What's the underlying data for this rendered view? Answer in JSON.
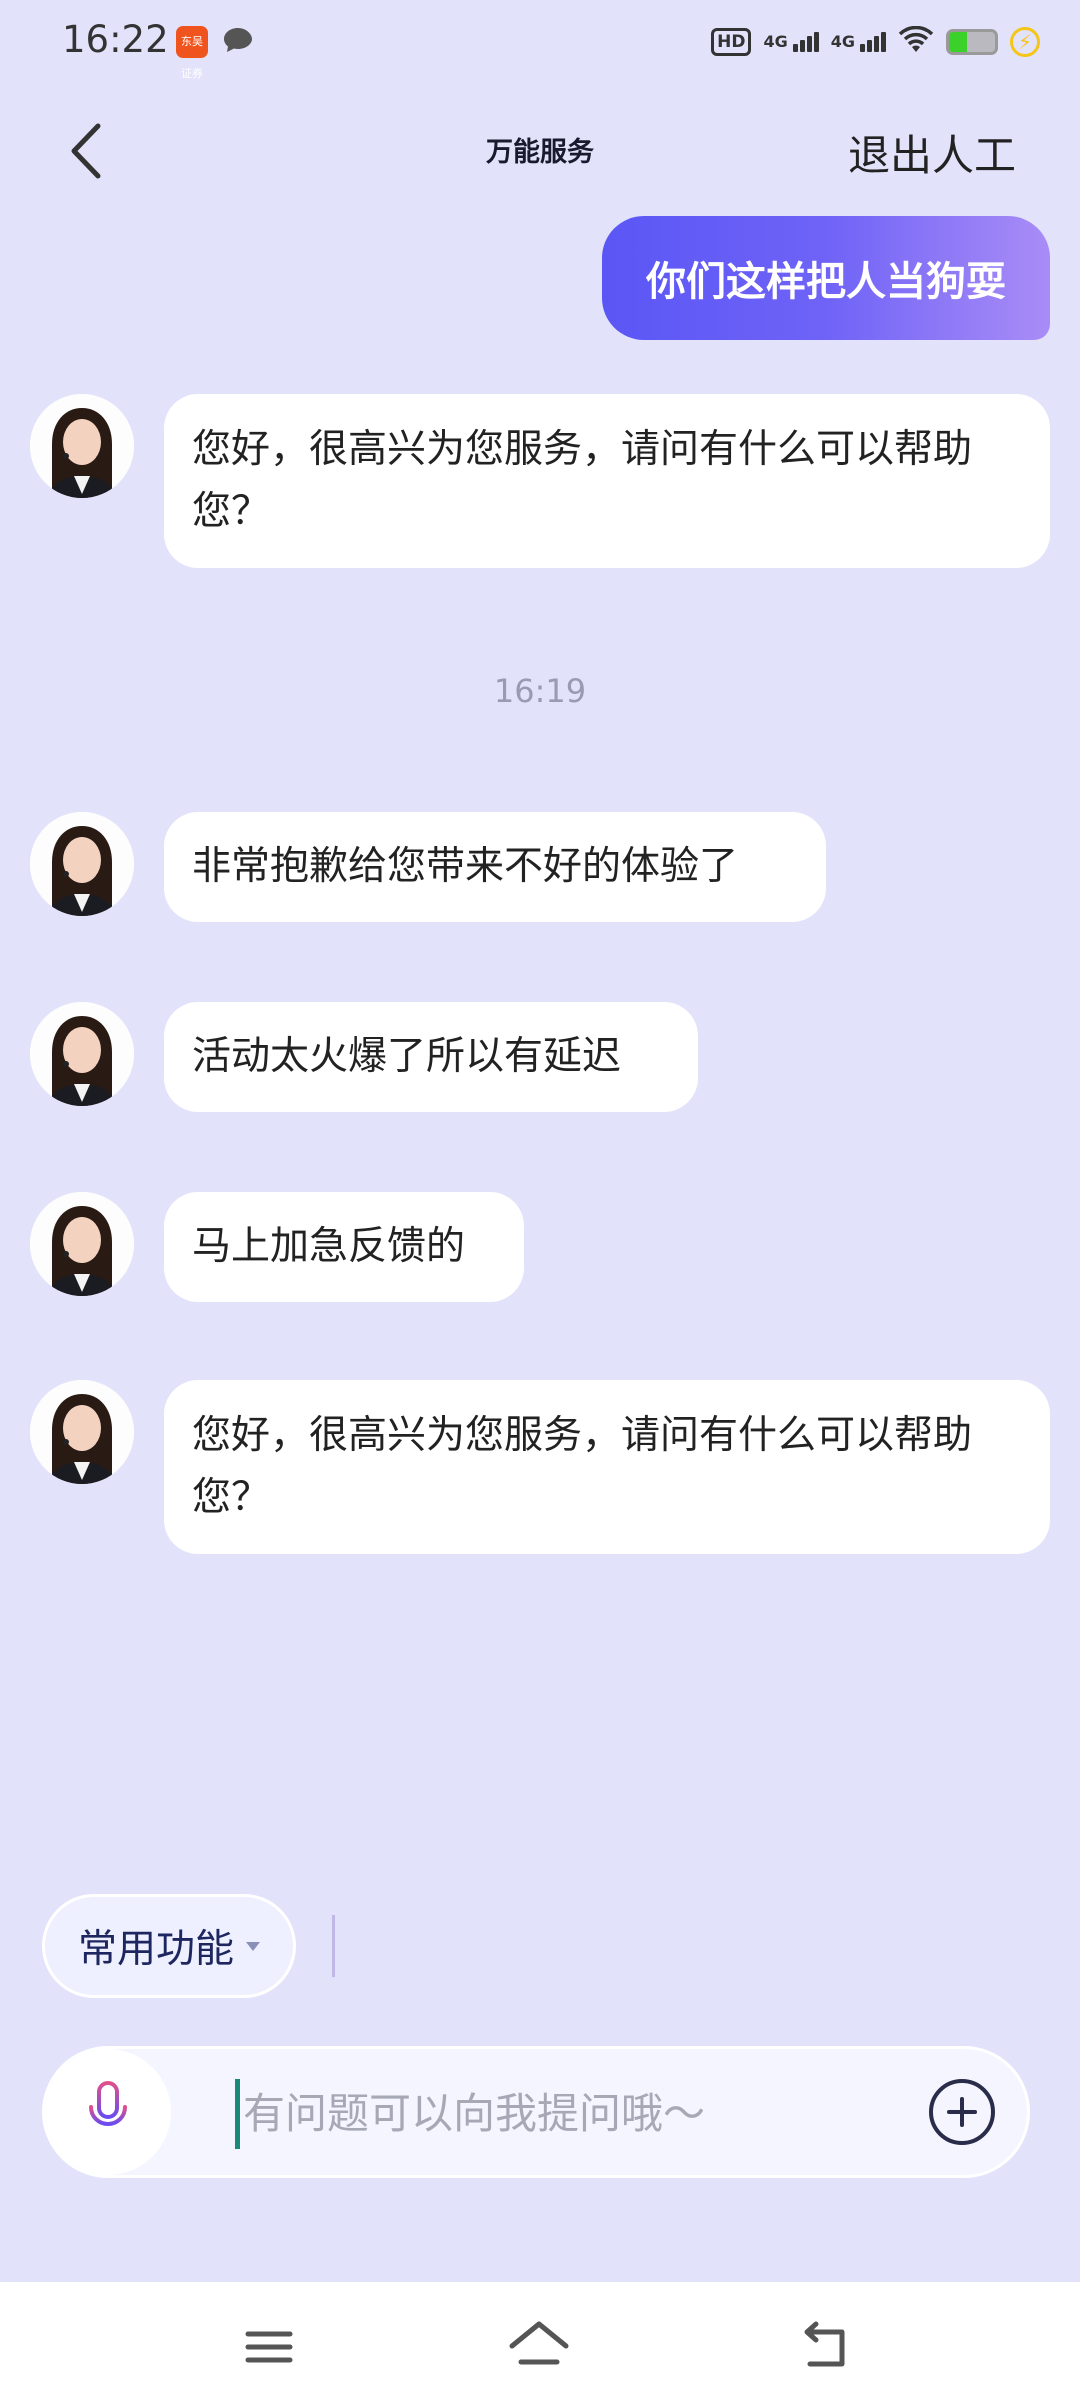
{
  "status_bar": {
    "time": "16:22",
    "app_badge": "东吴证券",
    "hd_label": "HD",
    "sim1_label": "4G",
    "sim2_label": "4G",
    "battery_level": 0.4,
    "icons": [
      "app-badge-icon",
      "message-icon",
      "hd-icon",
      "signal-icon",
      "signal-icon",
      "wifi-icon",
      "battery-icon",
      "charging-icon"
    ]
  },
  "header": {
    "title": "万能服务",
    "exit_label": "退出人工",
    "back_icon": "chevron-left-icon"
  },
  "chat": {
    "user_message": "你们这样把人当狗耍",
    "agent_messages": [
      "您好，很高兴为您服务，请问有什么可以帮助您？",
      "非常抱歉给您带来不好的体验了",
      "活动太火爆了所以有延迟",
      "马上加急反馈的",
      "您好，很高兴为您服务，请问有什么可以帮助您？"
    ],
    "timestamp": "16:19"
  },
  "composer": {
    "quick_label": "常用功能",
    "placeholder": "有问题可以向我提问哦～",
    "value": "",
    "mic_icon": "microphone-icon",
    "plus_icon": "plus-circle-icon"
  },
  "nav_bar": {
    "icons": [
      "menu-icon",
      "home-icon",
      "back-icon"
    ]
  },
  "colors": {
    "background": "#e2e3fb",
    "user_bubble_start": "#5a56f5",
    "user_bubble_end": "#a98cf6",
    "agent_bubble": "#ffffff"
  }
}
